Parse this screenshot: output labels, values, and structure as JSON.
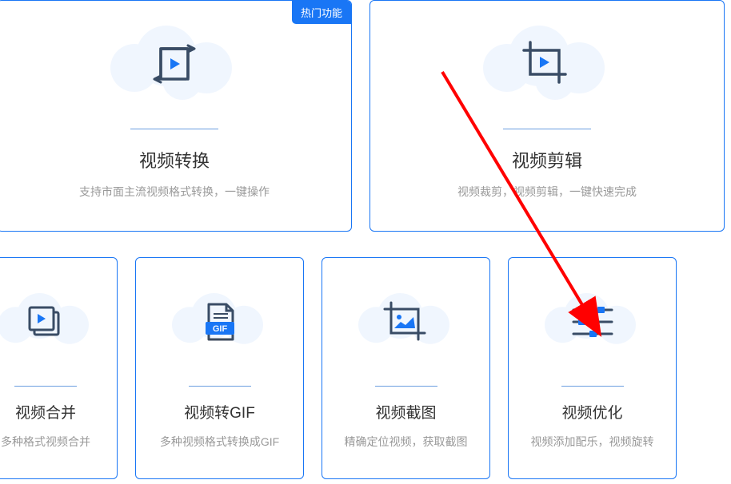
{
  "hot_badge": "热门功能",
  "cards_large": [
    {
      "title": "视频转换",
      "desc": "支持市面主流视频格式转换，一键操作"
    },
    {
      "title": "视频剪辑",
      "desc": "视频裁剪，视频剪辑，一键快速完成"
    }
  ],
  "cards_small": [
    {
      "title": "视频合并",
      "desc": "多种格式视频合并"
    },
    {
      "title": "视频转GIF",
      "desc": "多种视频格式转换成GIF"
    },
    {
      "title": "视频截图",
      "desc": "精确定位视频，获取截图"
    },
    {
      "title": "视频优化",
      "desc": "视频添加配乐，视频旋转"
    }
  ],
  "gif_label": "GIF"
}
